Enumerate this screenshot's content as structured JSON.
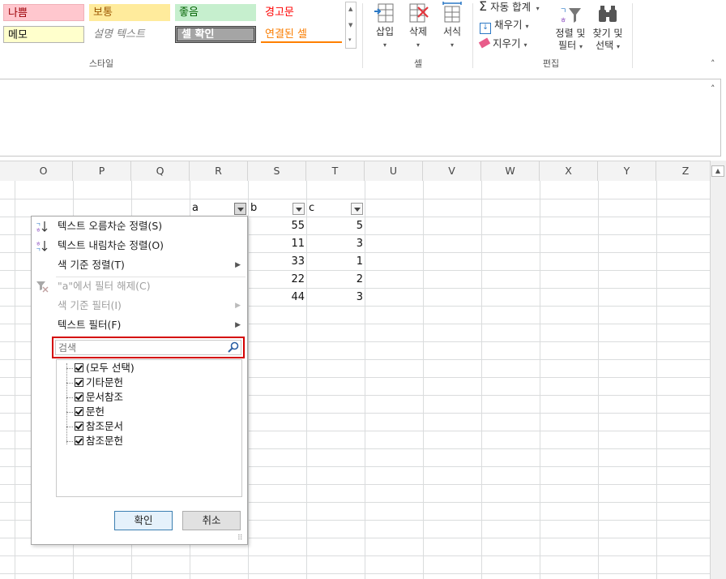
{
  "ribbon": {
    "styles": {
      "row1": [
        "나쁨",
        "보통",
        "좋음",
        "경고문"
      ],
      "row2": [
        "메모",
        "설명 텍스트",
        "셀 확인",
        "연결된 셀"
      ],
      "group_label": "스타일"
    },
    "cells": {
      "insert": "삽입",
      "delete": "삭제",
      "format": "서식",
      "group_label": "셀"
    },
    "editing": {
      "autosum": "자동 합계",
      "fill": "채우기",
      "clear": "지우기",
      "sort_filter_line1": "정렬 및",
      "sort_filter_line2": "필터",
      "find_select_line1": "찾기 및",
      "find_select_line2": "선택",
      "group_label": "편집"
    }
  },
  "columns": [
    "O",
    "P",
    "Q",
    "R",
    "S",
    "T",
    "U",
    "V",
    "W",
    "X",
    "Y",
    "Z"
  ],
  "table": {
    "headers": [
      "a",
      "b",
      "c"
    ],
    "b_values": [
      "55",
      "11",
      "33",
      "22",
      "44"
    ],
    "c_values": [
      "5",
      "3",
      "1",
      "2",
      "3"
    ]
  },
  "filter_menu": {
    "sort_asc": "텍스트 오름차순 정렬(S)",
    "sort_desc": "텍스트 내림차순 정렬(O)",
    "sort_by_color": "색 기준 정렬(T)",
    "clear_filter": "\"a\"에서 필터 해제(C)",
    "filter_by_color": "색 기준 필터(I)",
    "text_filter": "텍스트 필터(F)",
    "search_placeholder": "검색",
    "items": [
      "(모두 선택)",
      "기타문헌",
      "문서참조",
      "문헌",
      "참조문서",
      "참조문헌"
    ],
    "ok": "확인",
    "cancel": "취소"
  },
  "colors": {
    "bad_bg": "#ffc7ce",
    "bad_fg": "#9c0006",
    "neutral_bg": "#ffeb9c",
    "neutral_fg": "#9c5700",
    "good_bg": "#c6efce",
    "good_fg": "#006100",
    "warning_fg": "#ff0000",
    "note_bg": "#ffffcc",
    "check_bg": "#a5a5a5",
    "linked_fg": "#fa7d00",
    "highlight": "#d40000"
  }
}
